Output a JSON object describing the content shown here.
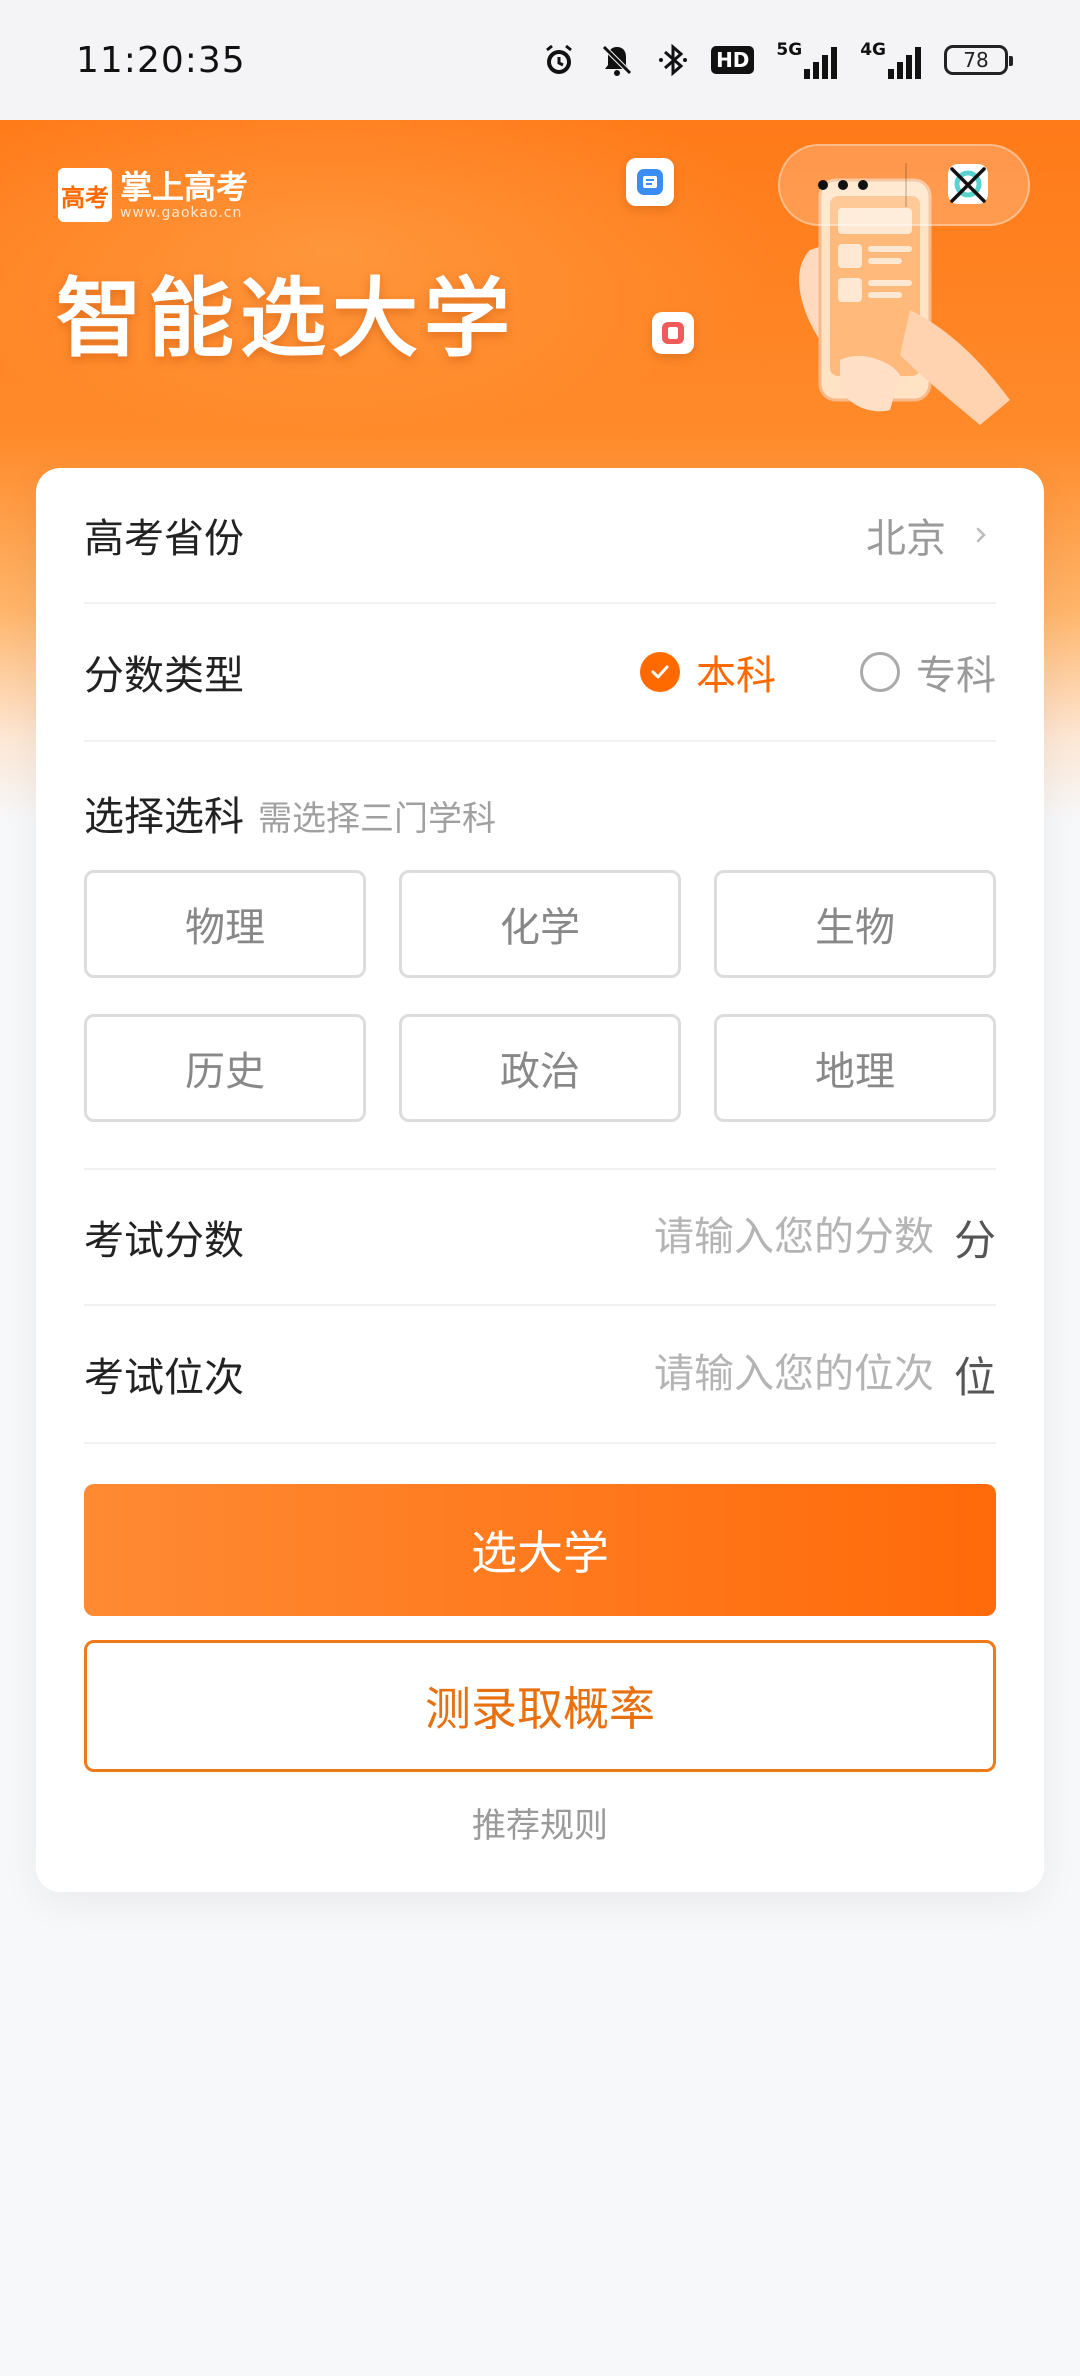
{
  "status_bar": {
    "time": "11:20:35",
    "hd_label": "HD",
    "net1_label": "5G",
    "net2_label": "4G",
    "battery": "78",
    "icons": [
      "alarm-icon",
      "mute-icon",
      "bluetooth-icon",
      "hd-icon",
      "signal-5g-icon",
      "signal-4g-icon",
      "battery-icon"
    ]
  },
  "hero": {
    "brand_mark": "高考",
    "brand_name": "掌上高考",
    "brand_url": "www.gaokao.cn",
    "title": "智能选大学"
  },
  "form": {
    "province": {
      "label": "高考省份",
      "value": "北京"
    },
    "score_type": {
      "label": "分数类型",
      "options": [
        {
          "label": "本科",
          "checked": true
        },
        {
          "label": "专科",
          "checked": false
        }
      ]
    },
    "subjects": {
      "title": "选择选科",
      "hint": "需选择三门学科",
      "items": [
        "物理",
        "化学",
        "生物",
        "历史",
        "政治",
        "地理"
      ]
    },
    "score": {
      "label": "考试分数",
      "placeholder": "请输入您的分数",
      "unit": "分"
    },
    "rank": {
      "label": "考试位次",
      "placeholder": "请输入您的位次",
      "unit": "位"
    }
  },
  "actions": {
    "primary": "选大学",
    "secondary": "测录取概率",
    "rules_link": "推荐规则"
  },
  "colors": {
    "accent": "#ff6a00",
    "banner_top": "#ff7a19",
    "page_bg": "#f7f8fa"
  }
}
